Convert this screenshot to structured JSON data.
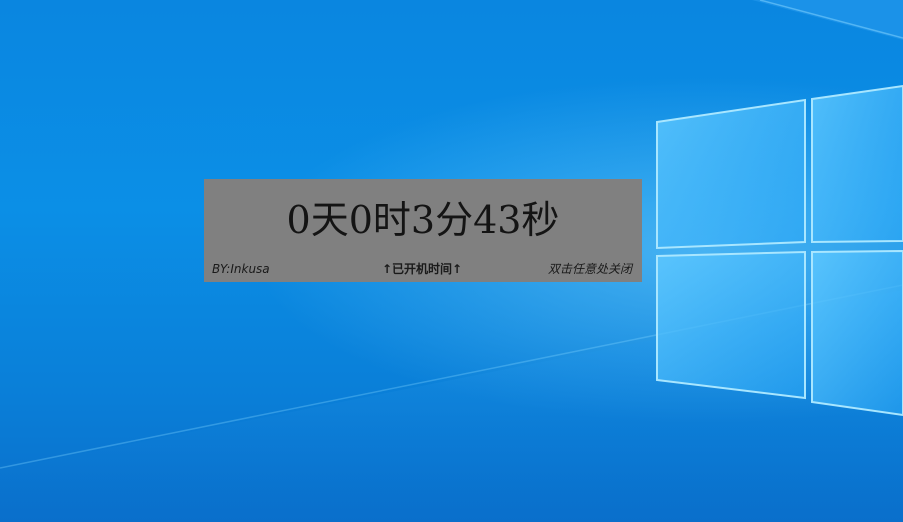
{
  "widget": {
    "uptime_text": "0天0时3分43秒",
    "author": "BY:Inkusa",
    "caption": "↑已开机时间↑",
    "close_hint": "双击任意处关闭",
    "background_color": "#808080",
    "text_color": "#141414"
  },
  "desktop": {
    "wallpaper": "windows-10-hero",
    "accent_color": "#0b8fe6"
  }
}
